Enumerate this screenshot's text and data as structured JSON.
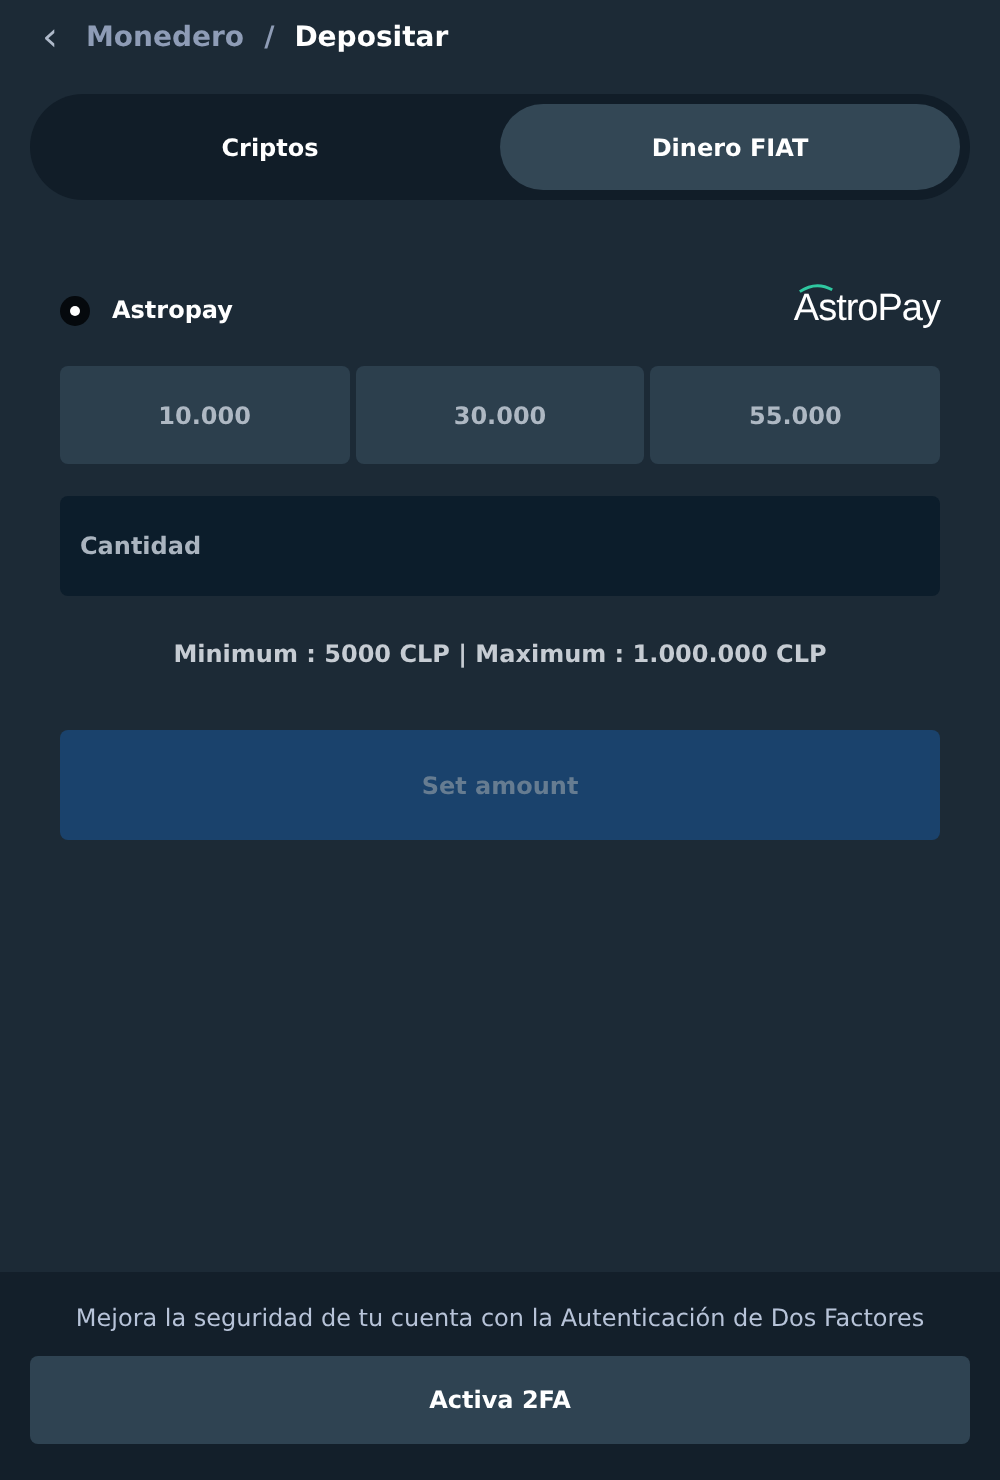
{
  "breadcrumb": {
    "back_icon": "‹",
    "parent": "Monedero",
    "separator": "/",
    "current": "Depositar"
  },
  "tabs": [
    {
      "label": "Criptos",
      "selected": false
    },
    {
      "label": "Dinero FIAT",
      "selected": true
    }
  ],
  "method": {
    "label": "Astropay",
    "selected": true,
    "logo": "AstroPay"
  },
  "presets": [
    "10.000",
    "30.000",
    "55.000"
  ],
  "amount_field": {
    "placeholder": "Cantidad"
  },
  "limits": "Minimum : 5000 CLP | Maximum : 1.000.000 CLP",
  "submit": {
    "label": "Set amount",
    "disabled": true
  },
  "footer": {
    "text": "Mejora la seguridad de tu cuenta con la Autenticación de Dos Factores",
    "button": "Activa 2FA"
  }
}
